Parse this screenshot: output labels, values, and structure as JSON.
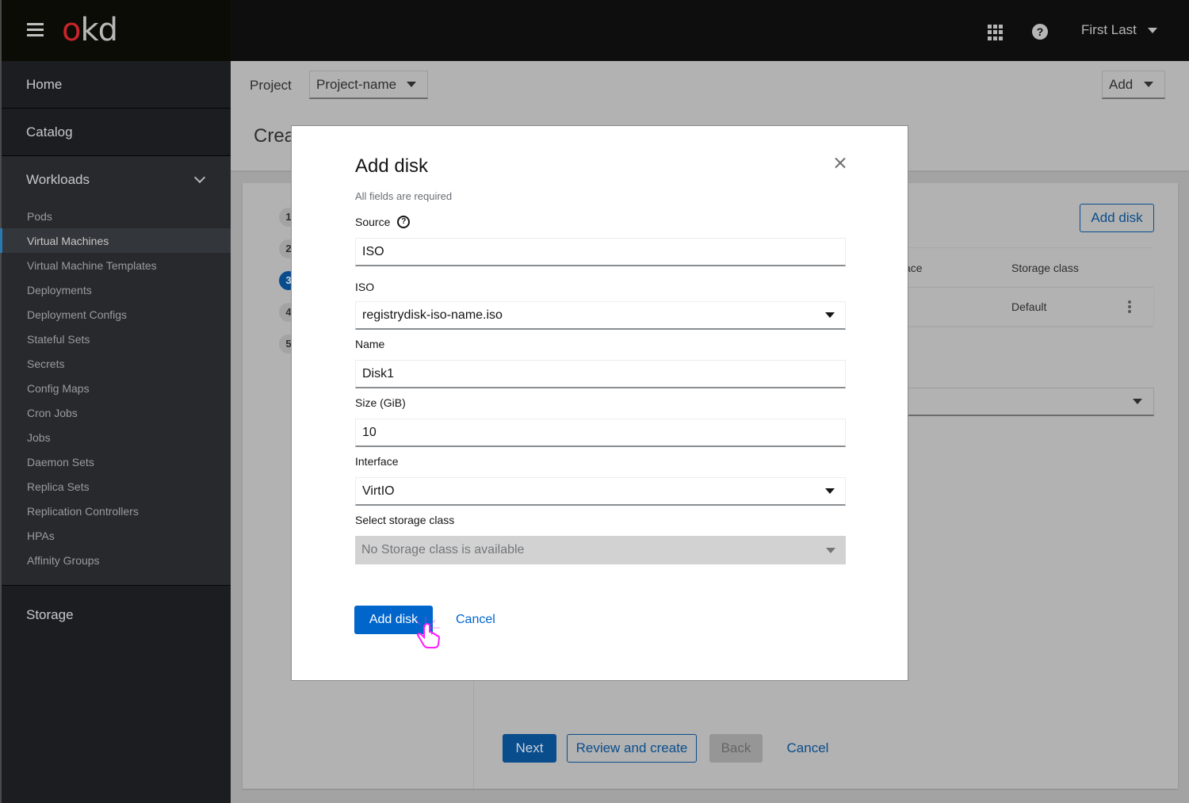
{
  "masthead": {
    "logo_o": "o",
    "logo_kd": "kd",
    "user_name": "First Last",
    "icons": [
      "menu-icon",
      "app-launcher-icon",
      "help-icon",
      "caret-down-icon"
    ]
  },
  "sidebar": {
    "top_items": [
      {
        "label": "Home"
      },
      {
        "label": "Catalog"
      }
    ],
    "workloads": {
      "label": "Workloads",
      "items": [
        {
          "label": "Pods",
          "active": false
        },
        {
          "label": "Virtual Machines",
          "active": true
        },
        {
          "label": "Virtual Machine Templates",
          "active": false
        },
        {
          "label": "Deployments",
          "active": false
        },
        {
          "label": "Deployment Configs",
          "active": false
        },
        {
          "label": "Stateful Sets",
          "active": false
        },
        {
          "label": "Secrets",
          "active": false
        },
        {
          "label": "Config Maps",
          "active": false
        },
        {
          "label": "Cron Jobs",
          "active": false
        },
        {
          "label": "Jobs",
          "active": false
        },
        {
          "label": "Daemon Sets",
          "active": false
        },
        {
          "label": "Replica Sets",
          "active": false
        },
        {
          "label": "Replication Controllers",
          "active": false
        },
        {
          "label": "HPAs",
          "active": false
        },
        {
          "label": "Affinity Groups",
          "active": false
        }
      ]
    },
    "bottom_items": [
      {
        "label": "Storage"
      }
    ]
  },
  "project_bar": {
    "label": "Project",
    "selected": "Project-name",
    "add_label": "Add"
  },
  "page": {
    "title_visible": "Crea"
  },
  "wizard": {
    "steps": [
      "1",
      "2",
      "3",
      "4",
      "5"
    ],
    "active_step": 3,
    "add_disk_button": "Add disk",
    "table": {
      "headers": [
        "ace",
        "Storage class"
      ],
      "rows": [
        {
          "storage_class": "Default"
        }
      ]
    },
    "footer": {
      "next": "Next",
      "review": "Review and create",
      "back": "Back",
      "cancel": "Cancel"
    }
  },
  "modal": {
    "title": "Add disk",
    "required_note": "All fields are required",
    "fields": {
      "source": {
        "label": "Source",
        "value": "ISO"
      },
      "iso": {
        "label": "ISO",
        "value": "registrydisk-iso-name.iso"
      },
      "name": {
        "label": "Name",
        "value": "Disk1"
      },
      "size": {
        "label": "Size (GiB)",
        "value": "10"
      },
      "interface": {
        "label": "Interface",
        "value": "VirtIO"
      },
      "storage_class": {
        "label": "Select storage class",
        "value": "No Storage class is available",
        "disabled": true
      }
    },
    "submit_label": "Add disk",
    "cancel_label": "Cancel"
  },
  "colors": {
    "primary": "#0066cc",
    "logo_red": "#c8242b",
    "active_nav_border": "#2a7ab0"
  }
}
